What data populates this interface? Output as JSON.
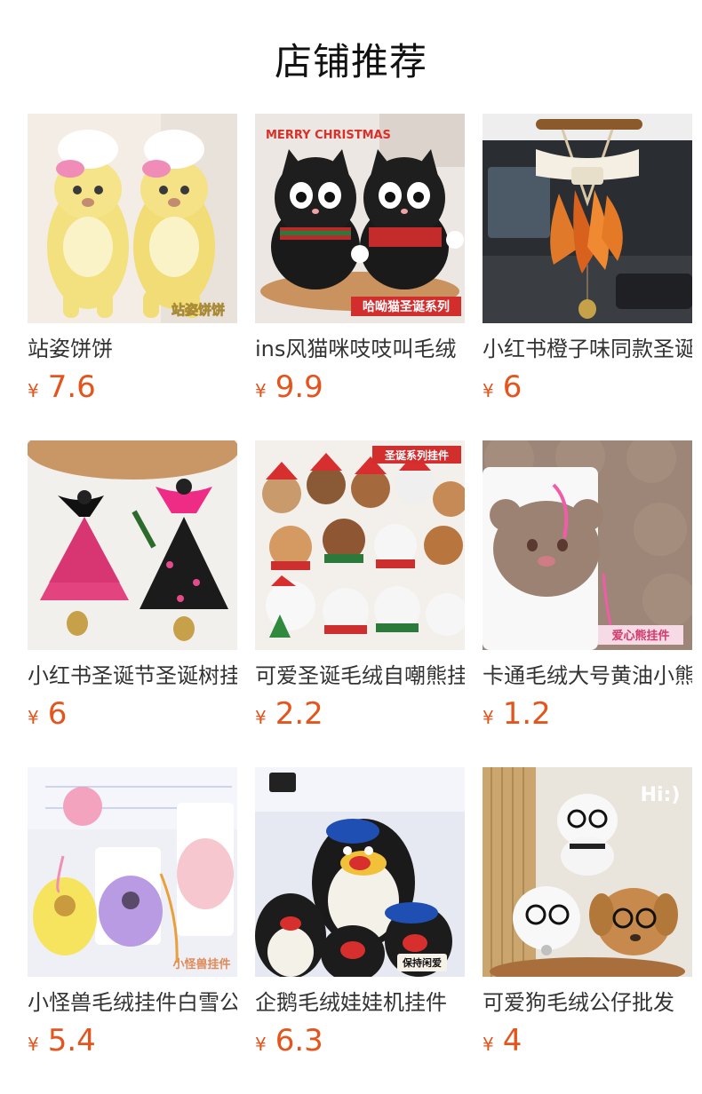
{
  "header": {
    "title": "店铺推荐"
  },
  "products": [
    {
      "name": "站姿饼饼",
      "currency": "¥",
      "price": "7.6",
      "image_caption": "站姿饼饼"
    },
    {
      "name": "ins风猫咪吱吱叫毛绒",
      "currency": "¥",
      "price": "9.9",
      "image_caption": "哈呦猫圣诞系列",
      "image_badge": "MERRY CHRISTMAS"
    },
    {
      "name": "小红书橙子味同款圣诞",
      "currency": "¥",
      "price": "6"
    },
    {
      "name": "小红书圣诞节圣诞树挂",
      "currency": "¥",
      "price": "6"
    },
    {
      "name": "可爱圣诞毛绒自嘲熊挂",
      "currency": "¥",
      "price": "2.2",
      "image_caption": "圣诞系列挂件"
    },
    {
      "name": "卡通毛绒大号黄油小熊",
      "currency": "¥",
      "price": "1.2",
      "image_caption": "爱心熊挂件"
    },
    {
      "name": "小怪兽毛绒挂件白雪公",
      "currency": "¥",
      "price": "5.4",
      "image_caption": "小怪兽挂件"
    },
    {
      "name": "企鹅毛绒娃娃机挂件",
      "currency": "¥",
      "price": "6.3",
      "image_caption": "保持闲爱"
    },
    {
      "name": "可爱狗毛绒公仔批发",
      "currency": "¥",
      "price": "4",
      "image_badge": "Hi:)"
    }
  ]
}
